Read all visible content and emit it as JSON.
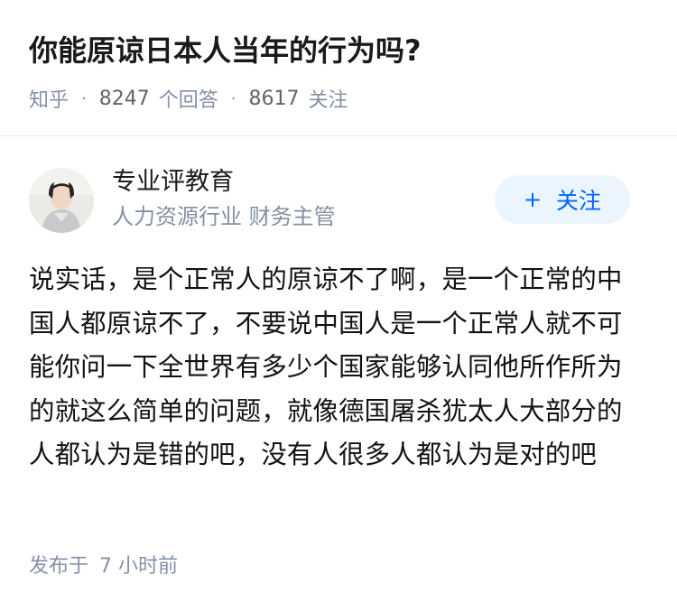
{
  "question": {
    "title": "你能原谅日本人当年的行为吗?",
    "source": "知乎",
    "answer_count": "8247",
    "answer_count_label": "个回答",
    "follower_count": "8617",
    "follower_label": "关注"
  },
  "author": {
    "name": "专业评教育",
    "headline": "人力资源行业 财务主管",
    "follow_plus": "+",
    "follow_label": "关注"
  },
  "answer": {
    "content": "说实话，是个正常人的原谅不了啊，是一个正常的中国人都原谅不了，不要说中国人是一个正常人就不可能你问一下全世界有多少个国家能够认同他所作所为的就这么简单的问题，就像德国屠杀犹太人大部分的人都认为是错的吧，没有人很多人都认为是对的吧",
    "publish_label": "发布于",
    "publish_time": "7 小时前"
  },
  "colors": {
    "accent": "#0066ff",
    "follow_bg": "#ebf5fd",
    "meta": "#8590a6"
  },
  "icons": {
    "avatar": "avatar-photo",
    "separator": "dot-separator"
  }
}
